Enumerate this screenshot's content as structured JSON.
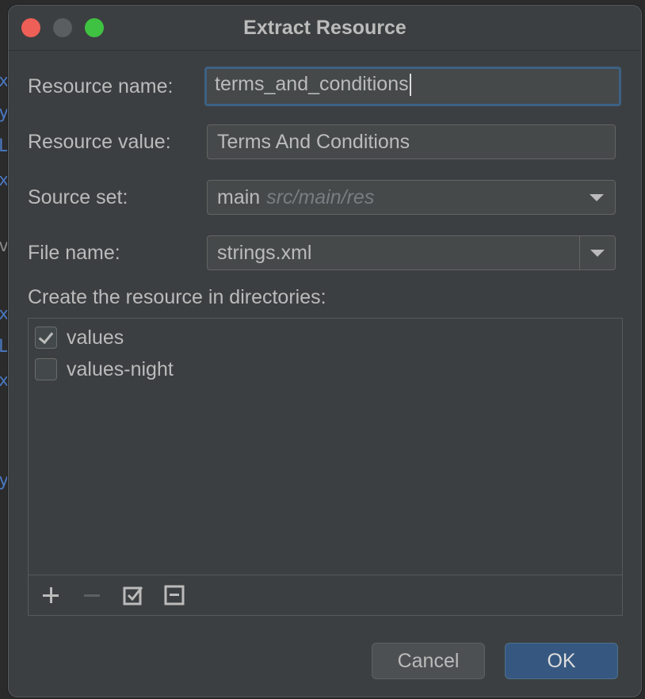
{
  "dialog": {
    "title": "Extract Resource"
  },
  "form": {
    "resource_name_label": "Resource name:",
    "resource_name_value": "terms_and_conditions",
    "resource_value_label": "Resource value:",
    "resource_value_value": "Terms And Conditions",
    "source_set_label": "Source set:",
    "source_set_value": "main",
    "source_set_hint": "src/main/res",
    "file_name_label": "File name:",
    "file_name_value": "strings.xml"
  },
  "directories": {
    "label": "Create the resource in directories:",
    "items": [
      {
        "name": "values",
        "checked": true
      },
      {
        "name": "values-night",
        "checked": false
      }
    ]
  },
  "buttons": {
    "cancel": "Cancel",
    "ok": "OK"
  },
  "background_glyphs": [
    "x",
    "y",
    "L",
    "x",
    "v",
    "x",
    "L",
    "x",
    "y"
  ],
  "colors": {
    "dialog_bg": "#3c3f41",
    "accent": "#365880",
    "focus_border": "#3d6185",
    "text": "#bbbbbb"
  }
}
